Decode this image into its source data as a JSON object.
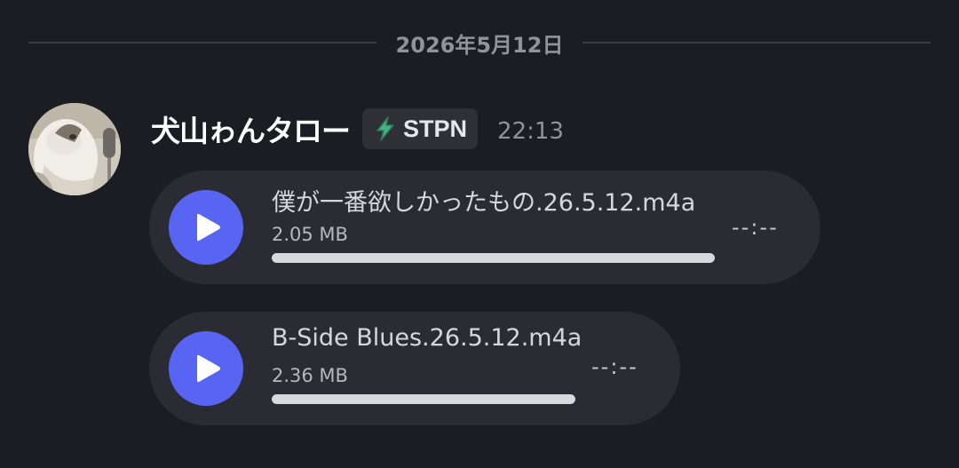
{
  "date_divider": "2026年5月12日",
  "message": {
    "username": "犬山ゎんタロー",
    "tag": {
      "icon": "lightning-icon",
      "label": "STPN",
      "icon_color": "#43b581"
    },
    "timestamp": "22:13",
    "attachments": [
      {
        "filename": "僕が一番欲しかったもの.26.5.12.m4a",
        "size": "2.05 MB",
        "duration": "--:--",
        "progress": 1.0
      },
      {
        "filename": "B-Side Blues.26.5.12.m4a",
        "size": "2.36 MB",
        "duration": "--:--",
        "progress": 1.0
      }
    ]
  },
  "colors": {
    "background": "#1c1d22",
    "accent": "#5865f2",
    "attachment_bg": "#2b2c33"
  }
}
